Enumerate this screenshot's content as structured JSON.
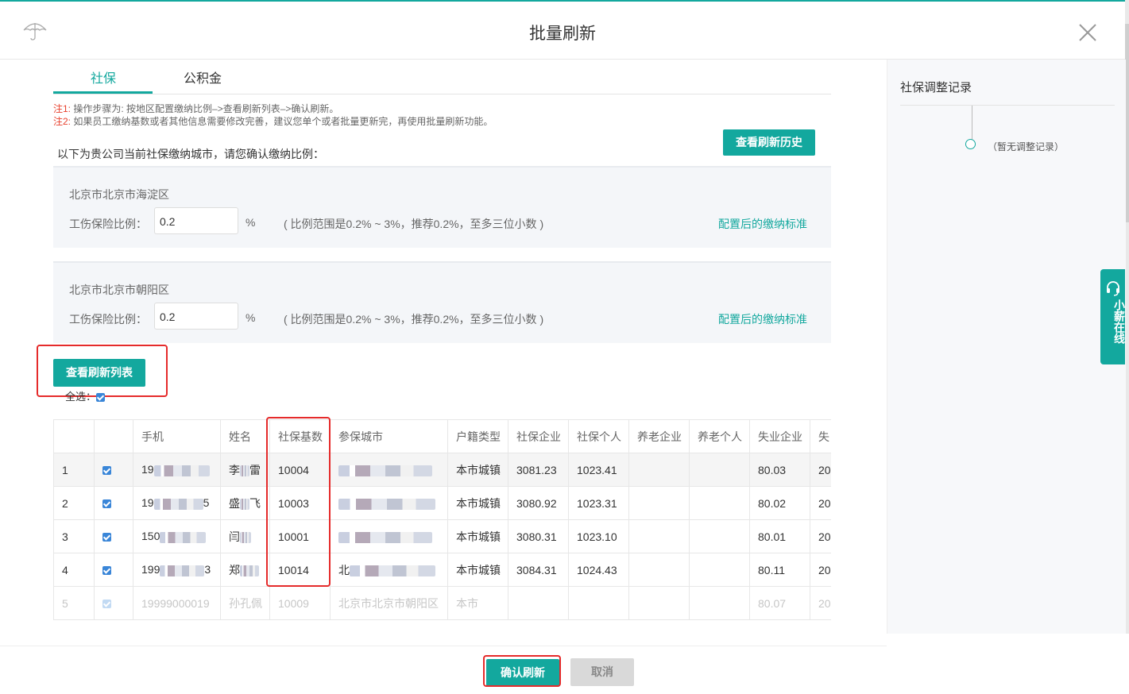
{
  "dialog": {
    "title": "批量刷新",
    "logo_icon": "umbrella-icon",
    "close_icon": "close-icon"
  },
  "tabs": [
    {
      "label": "社保",
      "active": true
    },
    {
      "label": "公积金",
      "active": false
    }
  ],
  "notes": {
    "note1_prefix": "注1:",
    "note1_text": " 操作步骤为: 按地区配置缴纳比例–>查看刷新列表–>确认刷新。",
    "note2_prefix": "注2:",
    "note2_text": " 如果员工缴纳基数或者其他信息需要修改完善，建议您单个或者批量更新完，再使用批量刷新功能。"
  },
  "intro": "以下为贵公司当前社保缴纳城市，请您确认缴纳比例：",
  "history_button": "查看刷新历史",
  "cities": [
    {
      "name": "北京市北京市海淀区",
      "ratio_label": "工伤保险比例：",
      "ratio_value": "0.2",
      "unit": "%",
      "hint": "( 比例范围是0.2% ~ 3%，推荐0.2%，至多三位小数 )",
      "link": "配置后的缴纳标准"
    },
    {
      "name": "北京市北京市朝阳区",
      "ratio_label": "工伤保险比例：",
      "ratio_value": "0.2",
      "unit": "%",
      "hint": "( 比例范围是0.2% ~ 3%，推荐0.2%，至多三位小数 )",
      "link": "配置后的缴纳标准"
    }
  ],
  "list_button": "查看刷新列表",
  "select_all": "全选：",
  "table": {
    "headers": [
      "",
      "",
      "手机",
      "姓名",
      "社保基数",
      "参保城市",
      "户籍类型",
      "社保企业",
      "社保个人",
      "养老企业",
      "养老个人",
      "失业企业",
      "失"
    ],
    "rows": [
      {
        "idx": "1",
        "phone_a": "19",
        "phone_b": "",
        "name_a": "李",
        "name_b": "雷",
        "base": "10004",
        "city_a": "",
        "type": "本市城镇",
        "corp": "3081.23",
        "pers": "1023.41",
        "unemp": "80.03",
        "tail": "20"
      },
      {
        "idx": "2",
        "phone_a": "19",
        "phone_b": "5",
        "name_a": "盛",
        "name_b": "飞",
        "base": "10003",
        "city_a": "",
        "type": "本市城镇",
        "corp": "3080.92",
        "pers": "1023.31",
        "unemp": "80.02",
        "tail": "20"
      },
      {
        "idx": "3",
        "phone_a": "150",
        "phone_b": "",
        "name_a": "闫",
        "name_b": "",
        "base": "10001",
        "city_a": "",
        "type": "本市城镇",
        "corp": "3080.31",
        "pers": "1023.10",
        "unemp": "80.01",
        "tail": "20"
      },
      {
        "idx": "4",
        "phone_a": "199",
        "phone_b": "3",
        "name_a": "郑",
        "name_b": "",
        "base": "10014",
        "city_a": "北",
        "type": "本市城镇",
        "corp": "3084.31",
        "pers": "1024.43",
        "unemp": "80.11",
        "tail": "20"
      },
      {
        "idx": "5",
        "phone": "19999000019",
        "name": "孙孔佩",
        "base": "10009",
        "city": "北京市北京市朝阳区",
        "type": "本市",
        "unemp": "80.07",
        "tail": "20"
      }
    ]
  },
  "footer": {
    "confirm": "确认刷新",
    "cancel": "取消"
  },
  "sidebar": {
    "title": "社保调整记录",
    "empty": "（暂无调整记录）"
  },
  "service": {
    "label": "小薪在线",
    "icon": "headset-icon"
  },
  "colors": {
    "accent": "#13a89e",
    "highlight_box": "#e52b2b",
    "checkbox": "#3a86d8"
  }
}
